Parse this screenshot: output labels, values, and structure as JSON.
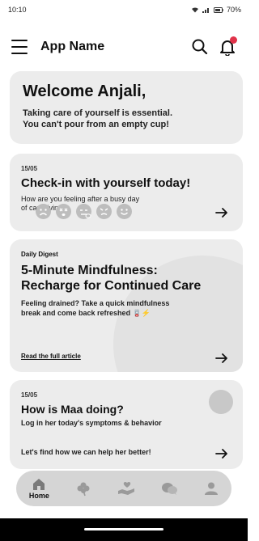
{
  "status_bar": {
    "time": "10:10",
    "battery": "70%"
  },
  "app_bar": {
    "title": "App Name"
  },
  "welcome": {
    "title": "Welcome Anjali,",
    "line1": "Taking care of yourself is essential.",
    "line2": "You can't pour from an empty cup!"
  },
  "checkin": {
    "date": "15/05",
    "title": "Check-in with yourself today!",
    "desc_line1": "How are you feeling after a busy day",
    "desc_line2": "of caregiving?",
    "moods": [
      "very-sad-face-icon",
      "dizzy-face-icon",
      "tired-face-icon",
      "angry-face-icon",
      "happy-face-icon"
    ]
  },
  "digest": {
    "label": "Daily Digest",
    "title_line1": "5-Minute Mindfulness:",
    "title_line2": "Recharge for Continued Care",
    "desc_line1": "Feeling drained? Take a quick mindfulness",
    "desc_line2": "break and come back refreshed 🪫⚡",
    "link": "Read the full article"
  },
  "maa": {
    "date": "15/05",
    "title": "How is Maa doing?",
    "desc": "Log in her today's symptoms & behavior",
    "cta": "Let's find how we can help her better!"
  },
  "bottom_nav": {
    "items": [
      {
        "icon": "home-icon",
        "label": "Home",
        "active": true
      },
      {
        "icon": "clover-icon"
      },
      {
        "icon": "care-hands-icon"
      },
      {
        "icon": "chat-bubbles-icon"
      },
      {
        "icon": "profile-icon"
      }
    ]
  },
  "colors": {
    "card_bg": "#ececec",
    "nav_bg": "#d5d5d5",
    "notification": "#e0334a"
  }
}
